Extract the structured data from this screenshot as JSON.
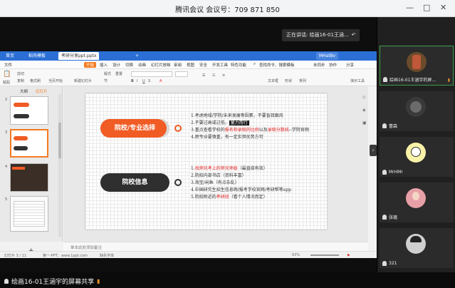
{
  "meeting": {
    "title": "腾讯会议 会议号：709 871 850",
    "speaking": "正在讲话: 绘画16-01王涵...",
    "share_label": "绘画16-01王涵宇的屏幕共享"
  },
  "wps": {
    "tabs": [
      "首页",
      "稻壳模板",
      "考研分享ppt.pptx"
    ],
    "menu": [
      "文件",
      "开始",
      "插入",
      "设计",
      "切换",
      "动画",
      "幻灯片放映",
      "审阅",
      "视图",
      "安全",
      "开发工具",
      "特色功能"
    ],
    "search_placeholder": "查找命令、搜索模板",
    "user": "MHat8v",
    "status_right": [
      "分享",
      "未同步",
      "协作"
    ],
    "ribbon": {
      "paste": "粘贴",
      "cut": "剪切",
      "copy": "复制",
      "format_painter": "格式刷",
      "from_current": "当页开始",
      "new_slide": "新建幻灯片",
      "layout": "版式",
      "section": "节",
      "reset": "重置",
      "text_box": "文本框",
      "shape": "形状",
      "arrange": "排列",
      "play": "演示工具"
    },
    "pane_tabs": [
      "大纲",
      "幻灯片"
    ],
    "notes_placeholder": "单击此处添加备注",
    "statusbar": {
      "slide_count": "幻灯片 3 / 11",
      "theme": "第一-PPT，www.1ppt.com",
      "missing_font": "缺失字体",
      "zoom": "63%"
    },
    "thumb_numbers": [
      "2",
      "3",
      "4",
      "5"
    ]
  },
  "slide": {
    "section1_title": "院校/专业选择",
    "section1_items": [
      "1.考虑地域/学院/未来发展等因素，不要盲目跟风",
      "2.不要过高或过低，",
      "3.重点查看学校的",
      "4.跨专业要慎重，有一定实但优势方可"
    ],
    "s1_item2_hl": "量力而行",
    "s1_item3_red1": "报名和录取的比例",
    "s1_item3_mid": "以及",
    "s1_item3_red2": "录取分数线",
    "s1_item3_tail": "--学院官网",
    "section2_title": "院校信息",
    "section2_items": [
      "找师兄考上的师兄师姐",
      "（最直接有效）",
      "2.院校内部书店（资料丰富）",
      "3.淘宝/闲鱼（有点杂乱）",
      "4.中国研究生招生信息网/报考学校官网/考研帮等app",
      "5.院校附近的",
      "考研班",
      "（看个人情况而定）"
    ],
    "s2_item1_prefix": "1."
  },
  "participants": [
    {
      "name": "绘画16-01王涵宇的屏...",
      "avatar": "photo-jar"
    },
    {
      "name": "蕾森",
      "avatar": "photo-dark"
    },
    {
      "name": "MrHMr",
      "avatar": "cartoon-face"
    },
    {
      "name": "张璐",
      "avatar": "photo-girl"
    },
    {
      "name": "321",
      "avatar": "photo-boy"
    }
  ],
  "colors": {
    "accent_orange": "#f15b24",
    "wps_blue": "#2b6fd6",
    "highlight_red": "#e02020",
    "signal": "#e0902a"
  }
}
